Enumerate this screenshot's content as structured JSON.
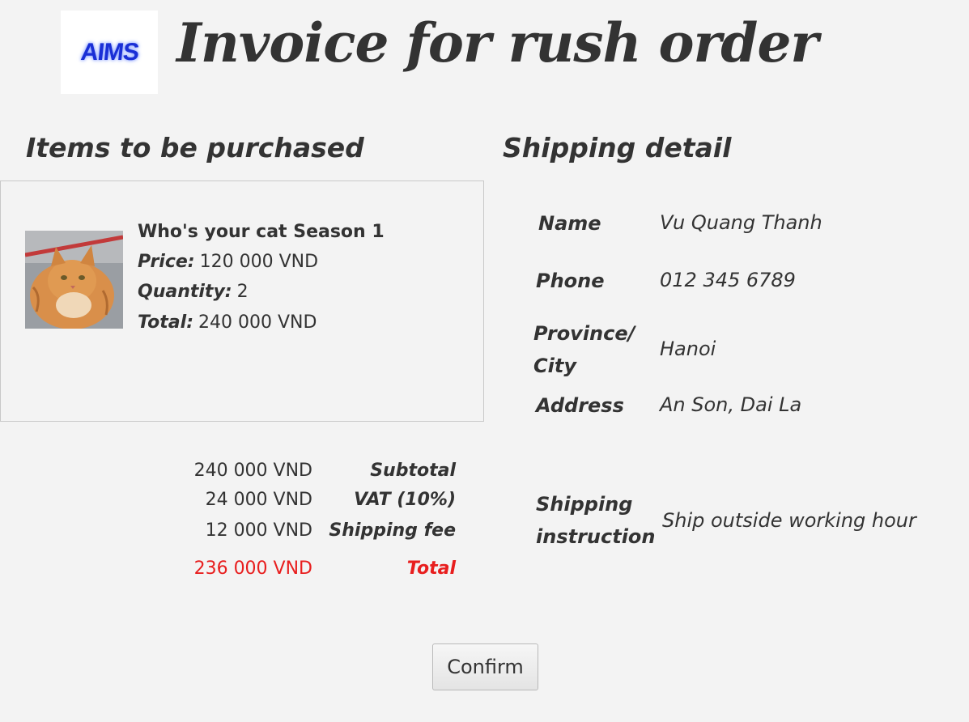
{
  "header": {
    "logo_text": "AIMS",
    "title": "Invoice for rush order"
  },
  "items_section": {
    "title": "Items to be purchased",
    "items": [
      {
        "name": "Who's your cat Season 1",
        "price_label": "Price:",
        "price_value": "120 000 VND",
        "quantity_label": "Quantity:",
        "quantity_value": "2",
        "total_label": "Total:",
        "total_value": "240 000 VND"
      }
    ]
  },
  "summary": {
    "subtotal_value": "240 000 VND",
    "subtotal_label": "Subtotal",
    "vat_value": "24 000 VND",
    "vat_label": "VAT (10%)",
    "shipping_value": "12 000 VND",
    "shipping_label": "Shipping fee",
    "total_value": "236 000 VND",
    "total_label": "Total",
    "total_color": "#e81e1e"
  },
  "shipping": {
    "title": "Shipping detail",
    "name_label": "Name",
    "name_value": "Vu Quang Thanh",
    "phone_label": "Phone",
    "phone_value": "012 345 6789",
    "province_label": "Province/ City",
    "province_value": "Hanoi",
    "address_label": "Address",
    "address_value": "An Son, Dai La",
    "instruction_label": "Shipping instruction",
    "instruction_value": "Ship outside working hour"
  },
  "actions": {
    "confirm_label": "Confirm"
  }
}
